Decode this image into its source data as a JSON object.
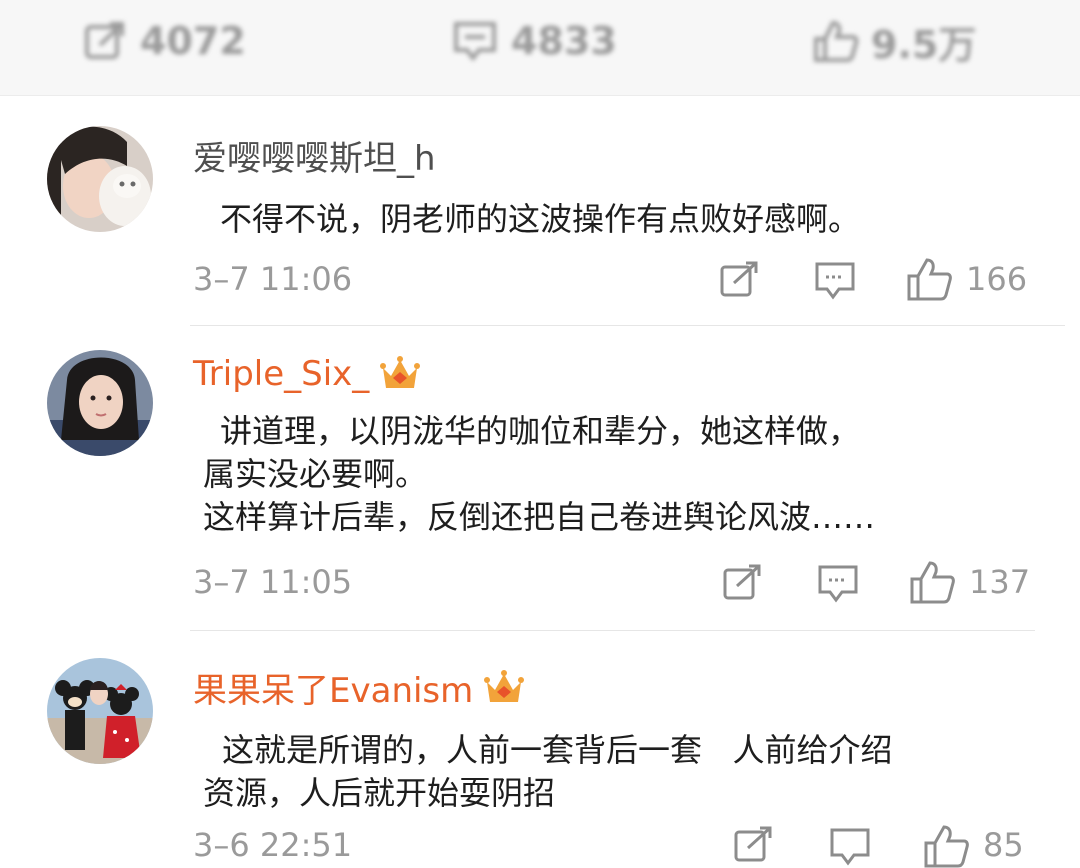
{
  "stats": {
    "repost_count": "4072",
    "comment_count": "4833",
    "like_count": "9.5万"
  },
  "comments": [
    {
      "username": "爱嘤嘤嘤斯坦_h",
      "vip": false,
      "text": "不得不说，阴老师的这波操作有点败好感啊。",
      "time": "3–7 11:06",
      "likes": "166"
    },
    {
      "username": "Triple_Six_",
      "vip": true,
      "text_lines": [
        "讲道理，以阴泷华的咖位和辈分，她这样做，",
        "属实没必要啊。",
        "这样算计后辈，反倒还把自己卷进舆论风波……"
      ],
      "time": "3–7 11:05",
      "likes": "137"
    },
    {
      "username": "果果呆了Evanism",
      "vip": true,
      "text_lines": [
        "这就是所谓的，人前一套背后一套   人前给介绍",
        "资源，人后就开始耍阴招"
      ],
      "time": "3–6 22:51",
      "likes": "85"
    }
  ],
  "icons": {
    "repost": "repost-icon",
    "comment": "comment-icon",
    "like": "thumbs-up-icon",
    "crown": "vip-crown-icon"
  },
  "colors": {
    "vip_name": "#e8632a",
    "normal_name": "#4f4f4f",
    "meta": "#9a9a9a",
    "crown": "#f2a33a"
  }
}
